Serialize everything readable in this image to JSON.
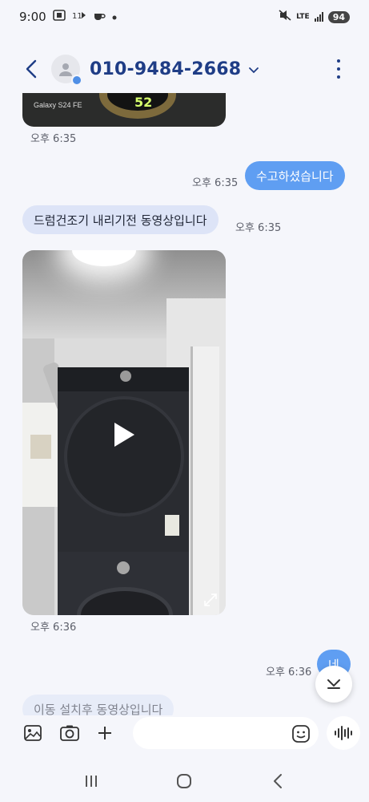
{
  "status_bar": {
    "time": "9:00",
    "network": "LTE",
    "battery": "94"
  },
  "header": {
    "contact": "010-9484-2668"
  },
  "messages": [
    {
      "id": "prev-image",
      "type": "image",
      "direction": "in",
      "caption": "Galaxy S24 FE"
    },
    {
      "id": "t1",
      "time": "오후 6:35"
    },
    {
      "id": "m1",
      "direction": "out",
      "text": "수고하셨습니다",
      "time": "오후 6:35"
    },
    {
      "id": "m2",
      "direction": "in",
      "text": "드럼건조기 내리기전 동영상입니다",
      "time": "오후 6:35"
    },
    {
      "id": "m3",
      "direction": "in",
      "type": "video",
      "time": "오후 6:36"
    },
    {
      "id": "m4",
      "direction": "out",
      "text": "네",
      "time": "오후 6:36"
    },
    {
      "id": "m5",
      "direction": "in",
      "text": "이동 설치후 동영상입니다"
    }
  ],
  "composer": {
    "placeholder": ""
  },
  "colors": {
    "background": "#f5f6fb",
    "incoming_bubble": "#dde4f7",
    "outgoing_bubble": "#5f9ef2",
    "header_text": "#1f3d86"
  }
}
